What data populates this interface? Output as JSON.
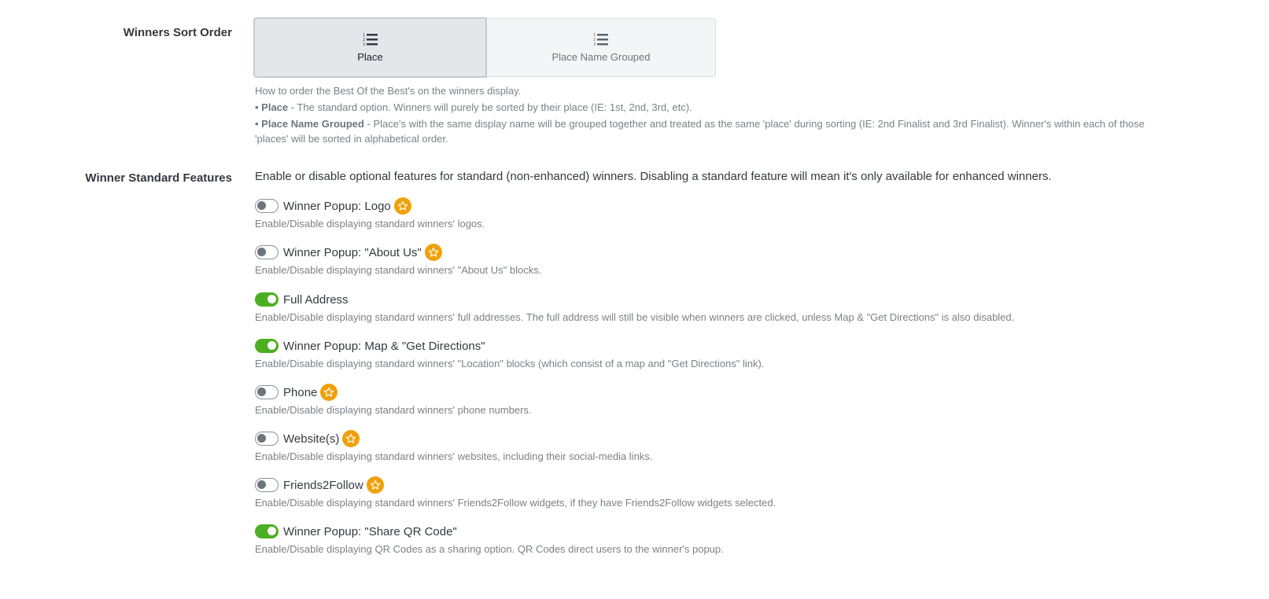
{
  "sort_order": {
    "label": "Winners Sort Order",
    "options": [
      {
        "label": "Place",
        "icon": "ordered-list-icon",
        "selected": true
      },
      {
        "label": "Place Name Grouped",
        "icon": "ordered-list-icon",
        "selected": false
      }
    ],
    "help_intro": "How to order the Best Of the Best's on the winners display.",
    "help_place_title": "• Place",
    "help_place_text": " - The standard option. Winners will purely be sorted by their place (IE: 1st, 2nd, 3rd, etc).",
    "help_grouped_title": "• Place Name Grouped",
    "help_grouped_text": " - Place's with the same display name will be grouped together and treated as the same 'place' during sorting (IE: 2nd Finalist and 3rd Finalist). Winner's within each of those 'places' will be sorted in alphabetical order."
  },
  "standard_features": {
    "label": "Winner Standard Features",
    "intro": "Enable or disable optional features for standard (non-enhanced) winners. Disabling a standard feature will mean it's only available for enhanced winners.",
    "items": [
      {
        "label": "Winner Popup: Logo",
        "enabled": false,
        "premium": true,
        "help": "Enable/Disable displaying standard winners' logos."
      },
      {
        "label": "Winner Popup: \"About Us\"",
        "enabled": false,
        "premium": true,
        "help": "Enable/Disable displaying standard winners' \"About Us\" blocks."
      },
      {
        "label": "Full Address",
        "enabled": true,
        "premium": false,
        "help": "Enable/Disable displaying standard winners' full addresses. The full address will still be visible when winners are clicked, unless Map & \"Get Directions\" is also disabled."
      },
      {
        "label": "Winner Popup: Map & \"Get Directions\"",
        "enabled": true,
        "premium": false,
        "help": "Enable/Disable displaying standard winners' \"Location\" blocks (which consist of a map and \"Get Directions\" link)."
      },
      {
        "label": "Phone",
        "enabled": false,
        "premium": true,
        "help": "Enable/Disable displaying standard winners' phone numbers."
      },
      {
        "label": "Website(s)",
        "enabled": false,
        "premium": true,
        "help": "Enable/Disable displaying standard winners' websites, including their social-media links."
      },
      {
        "label": "Friends2Follow",
        "enabled": false,
        "premium": true,
        "help": "Enable/Disable displaying standard winners' Friends2Follow widgets, if they have Friends2Follow widgets selected."
      },
      {
        "label": "Winner Popup: \"Share QR Code\"",
        "enabled": true,
        "premium": false,
        "help": "Enable/Disable displaying QR Codes as a sharing option. QR Codes direct users to the winner's popup."
      }
    ]
  },
  "colors": {
    "toggle_on": "#4caf1f",
    "premium_star": "#f0a10a"
  }
}
